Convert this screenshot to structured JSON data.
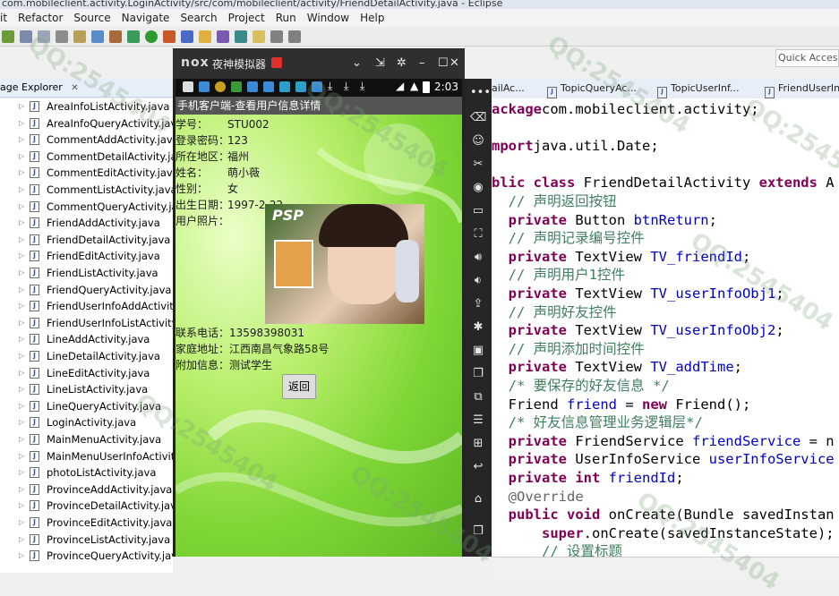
{
  "window": {
    "title": "com.mobileclient.activity.LoginActivity/src/com/mobileclient/activity/FriendDetailActivity.java - Eclipse"
  },
  "menu": [
    "it",
    "Refactor",
    "Source",
    "Navigate",
    "Search",
    "Project",
    "Run",
    "Window",
    "Help"
  ],
  "quick_access": "Quick Access",
  "package_explorer": {
    "title": "age Explorer",
    "files": [
      "AreaInfoListActivity.java",
      "AreaInfoQueryActivity.java",
      "CommentAddActivity.java",
      "CommentDetailActivity.java",
      "CommentEditActivity.java",
      "CommentListActivity.java",
      "CommentQueryActivity.java",
      "FriendAddActivity.java",
      "FriendDetailActivity.java",
      "FriendEditActivity.java",
      "FriendListActivity.java",
      "FriendQueryActivity.java",
      "FriendUserInfoAddActivity",
      "FriendUserInfoListActivity.j",
      "LineAddActivity.java",
      "LineDetailActivity.java",
      "LineEditActivity.java",
      "LineListActivity.java",
      "LineQueryActivity.java",
      "LoginActivity.java",
      "MainMenuActivity.java",
      "MainMenuUserInfoActivity",
      "photoListActivity.java",
      "ProvinceAddActivity.java",
      "ProvinceDetailActivity.java",
      "ProvinceEditActivity.java",
      "ProvinceListActivity.java",
      "ProvinceQueryActivity.java"
    ]
  },
  "emulator": {
    "brand": "nox",
    "title": "夜神模拟器",
    "time": "2:03",
    "app_title": "手机客户端-查看用户信息详情",
    "fields": [
      {
        "label": "学号：",
        "value": "STU002"
      },
      {
        "label": "登录密码：",
        "value": "123"
      },
      {
        "label": "所在地区：",
        "value": "福州"
      },
      {
        "label": "姓名：",
        "value": "萌小薇"
      },
      {
        "label": "性别：",
        "value": "女"
      },
      {
        "label": "出生日期：",
        "value": "1997-2-22"
      },
      {
        "label": "用户照片：",
        "value": ""
      }
    ],
    "photo_brand": "PSP",
    "contact_fields": [
      {
        "label": "联系电话：",
        "value": "13598398031"
      },
      {
        "label": "家庭地址：",
        "value": "江西南昌气象路58号"
      },
      {
        "label": "附加信息：",
        "value": "测试学生"
      }
    ],
    "return_button": "返回"
  },
  "editor": {
    "tabs": [
      "ailAc...",
      "TopicQueryAc...",
      "TopicUserInf...",
      "FriendUserIn..."
    ],
    "lines": [
      [
        [
          "kw",
          "ackage"
        ],
        [
          "",
          "com.mobileclient.activity;"
        ]
      ],
      [
        [
          "",
          ""
        ]
      ],
      [
        [
          "kw",
          "mport"
        ],
        [
          "",
          "java.util.Date;"
        ]
      ],
      [
        [
          "",
          ""
        ]
      ],
      [
        [
          "kw",
          "blic class"
        ],
        [
          "",
          " FriendDetailActivity "
        ],
        [
          "kw",
          "extends"
        ],
        [
          "",
          " A"
        ]
      ],
      [
        [
          "cm",
          "  // 声明返回按钮"
        ]
      ],
      [
        [
          "kw",
          "  private"
        ],
        [
          "",
          " Button "
        ],
        [
          "fd",
          "btnReturn"
        ],
        [
          "",
          ";"
        ]
      ],
      [
        [
          "cm",
          "  // 声明记录编号控件"
        ]
      ],
      [
        [
          "kw",
          "  private"
        ],
        [
          "",
          " TextView "
        ],
        [
          "fd",
          "TV_friendId"
        ],
        [
          "",
          ";"
        ]
      ],
      [
        [
          "cm",
          "  // 声明用户1控件"
        ]
      ],
      [
        [
          "kw",
          "  private"
        ],
        [
          "",
          " TextView "
        ],
        [
          "fd",
          "TV_userInfoObj1"
        ],
        [
          "",
          ";"
        ]
      ],
      [
        [
          "cm",
          "  // 声明好友控件"
        ]
      ],
      [
        [
          "kw",
          "  private"
        ],
        [
          "",
          " TextView "
        ],
        [
          "fd",
          "TV_userInfoObj2"
        ],
        [
          "",
          ";"
        ]
      ],
      [
        [
          "cm",
          "  // 声明添加时间控件"
        ]
      ],
      [
        [
          "kw",
          "  private"
        ],
        [
          "",
          " TextView "
        ],
        [
          "fd",
          "TV_addTime"
        ],
        [
          "",
          ";"
        ]
      ],
      [
        [
          "cm",
          "  /* 要保存的好友信息 */"
        ]
      ],
      [
        [
          "",
          "  Friend "
        ],
        [
          "fd",
          "friend"
        ],
        [
          "",
          " = "
        ],
        [
          "kw",
          "new"
        ],
        [
          "",
          " Friend();"
        ]
      ],
      [
        [
          "cm",
          "  /* 好友信息管理业务逻辑层*/"
        ]
      ],
      [
        [
          "kw",
          "  private"
        ],
        [
          "",
          " FriendService "
        ],
        [
          "fd",
          "friendService"
        ],
        [
          "",
          " = n"
        ]
      ],
      [
        [
          "kw",
          "  private"
        ],
        [
          "",
          " UserInfoService "
        ],
        [
          "fd",
          "userInfoService"
        ]
      ],
      [
        [
          "kw",
          "  private int"
        ],
        [
          "",
          " "
        ],
        [
          "fd",
          "friendId"
        ],
        [
          "",
          ";"
        ]
      ],
      [
        [
          "an",
          "  @Override"
        ]
      ],
      [
        [
          "kw",
          "  public void"
        ],
        [
          "",
          " onCreate(Bundle savedInstan"
        ]
      ],
      [
        [
          "kw",
          "      super"
        ],
        [
          "",
          ".onCreate(savedInstanceState);"
        ]
      ],
      [
        [
          "cm",
          "      // 设置标题"
        ]
      ]
    ]
  },
  "watermark": "QQ:2545404"
}
